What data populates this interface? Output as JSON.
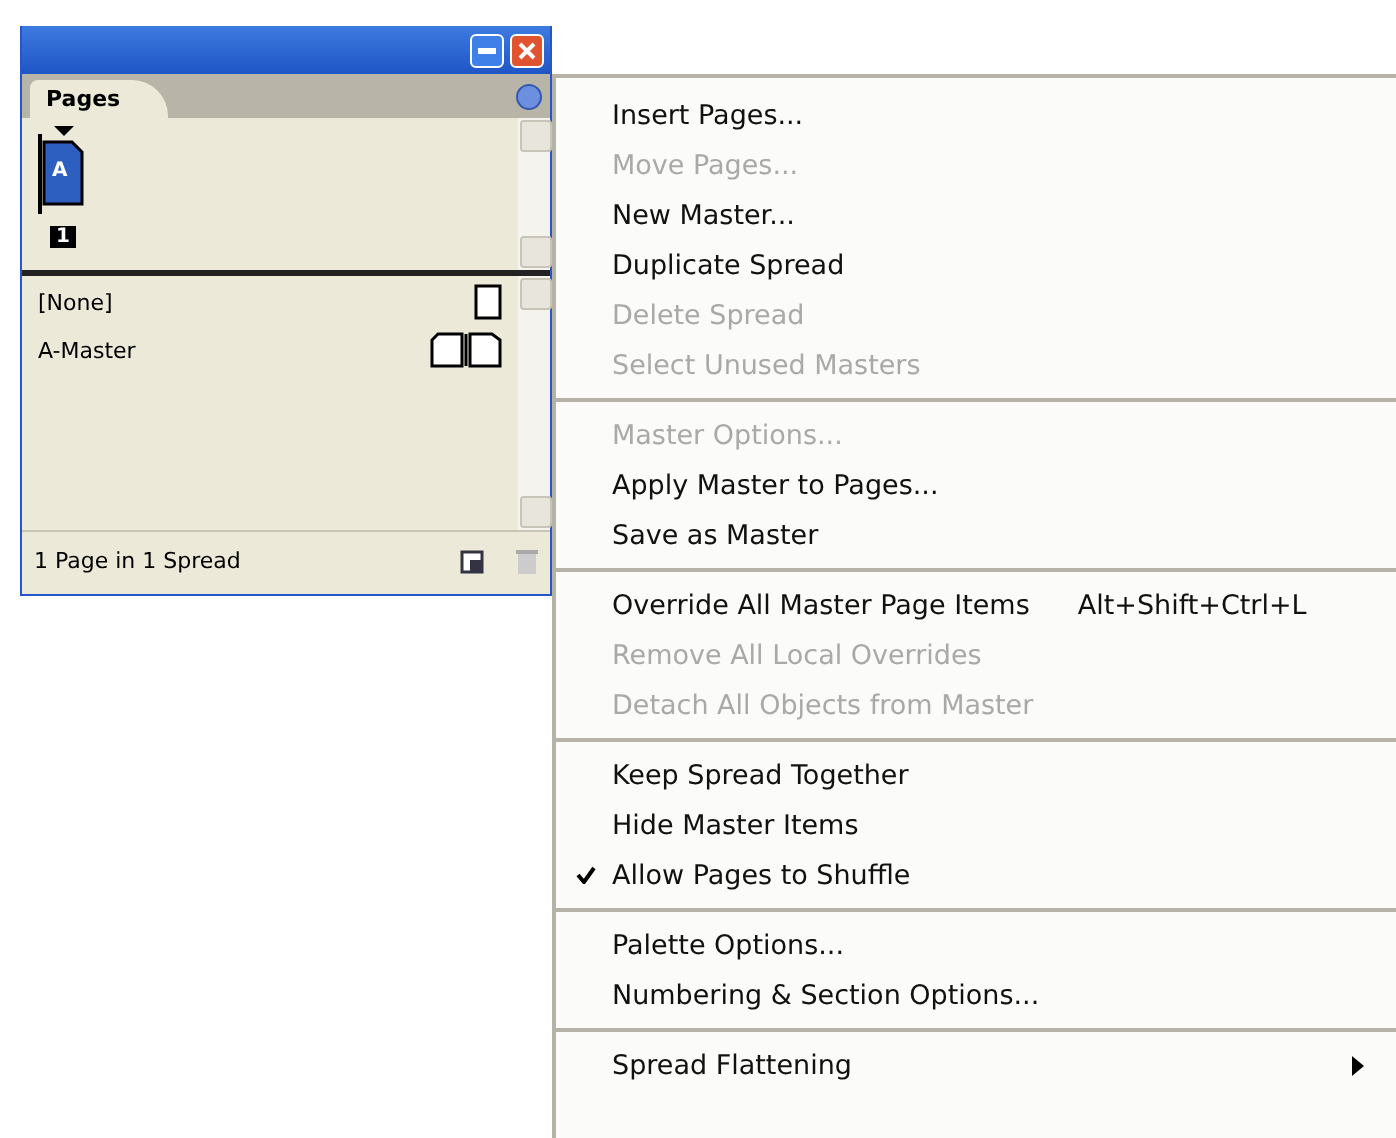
{
  "panel": {
    "tab": {
      "label": "Pages",
      "selected": true
    },
    "page_thumbnail": {
      "master_letter": "A",
      "page_number": "1"
    },
    "masters": [
      {
        "label": "[None]",
        "kind": "single"
      },
      {
        "label": "A-Master",
        "kind": "spread"
      }
    ],
    "status": "1 Page in 1 Spread"
  },
  "menu": {
    "groups": [
      [
        {
          "label": "Insert Pages...",
          "disabled": false,
          "checked": false
        },
        {
          "label": "Move Pages...",
          "disabled": true,
          "checked": false
        },
        {
          "label": "New Master...",
          "disabled": false,
          "checked": false
        },
        {
          "label": "Duplicate Spread",
          "disabled": false,
          "checked": false
        },
        {
          "label": "Delete Spread",
          "disabled": true,
          "checked": false
        },
        {
          "label": "Select Unused Masters",
          "disabled": true,
          "checked": false
        }
      ],
      [
        {
          "label": "Master Options...",
          "disabled": true,
          "checked": false
        },
        {
          "label": "Apply Master to Pages...",
          "disabled": false,
          "checked": false
        },
        {
          "label": "Save as Master",
          "disabled": false,
          "checked": false
        }
      ],
      [
        {
          "label": "Override All Master Page Items",
          "shortcut": "Alt+Shift+Ctrl+L",
          "disabled": false,
          "checked": false
        },
        {
          "label": "Remove All Local Overrides",
          "disabled": true,
          "checked": false
        },
        {
          "label": "Detach All Objects from Master",
          "disabled": true,
          "checked": false
        }
      ],
      [
        {
          "label": "Keep Spread Together",
          "disabled": false,
          "checked": false
        },
        {
          "label": "Hide Master Items",
          "disabled": false,
          "checked": false
        },
        {
          "label": "Allow Pages to Shuffle",
          "disabled": false,
          "checked": true
        }
      ],
      [
        {
          "label": "Palette Options...",
          "disabled": false,
          "checked": false
        },
        {
          "label": "Numbering & Section Options...",
          "disabled": false,
          "checked": false
        }
      ],
      [
        {
          "label": "Spread Flattening",
          "disabled": false,
          "checked": false,
          "submenu": true
        }
      ]
    ]
  }
}
